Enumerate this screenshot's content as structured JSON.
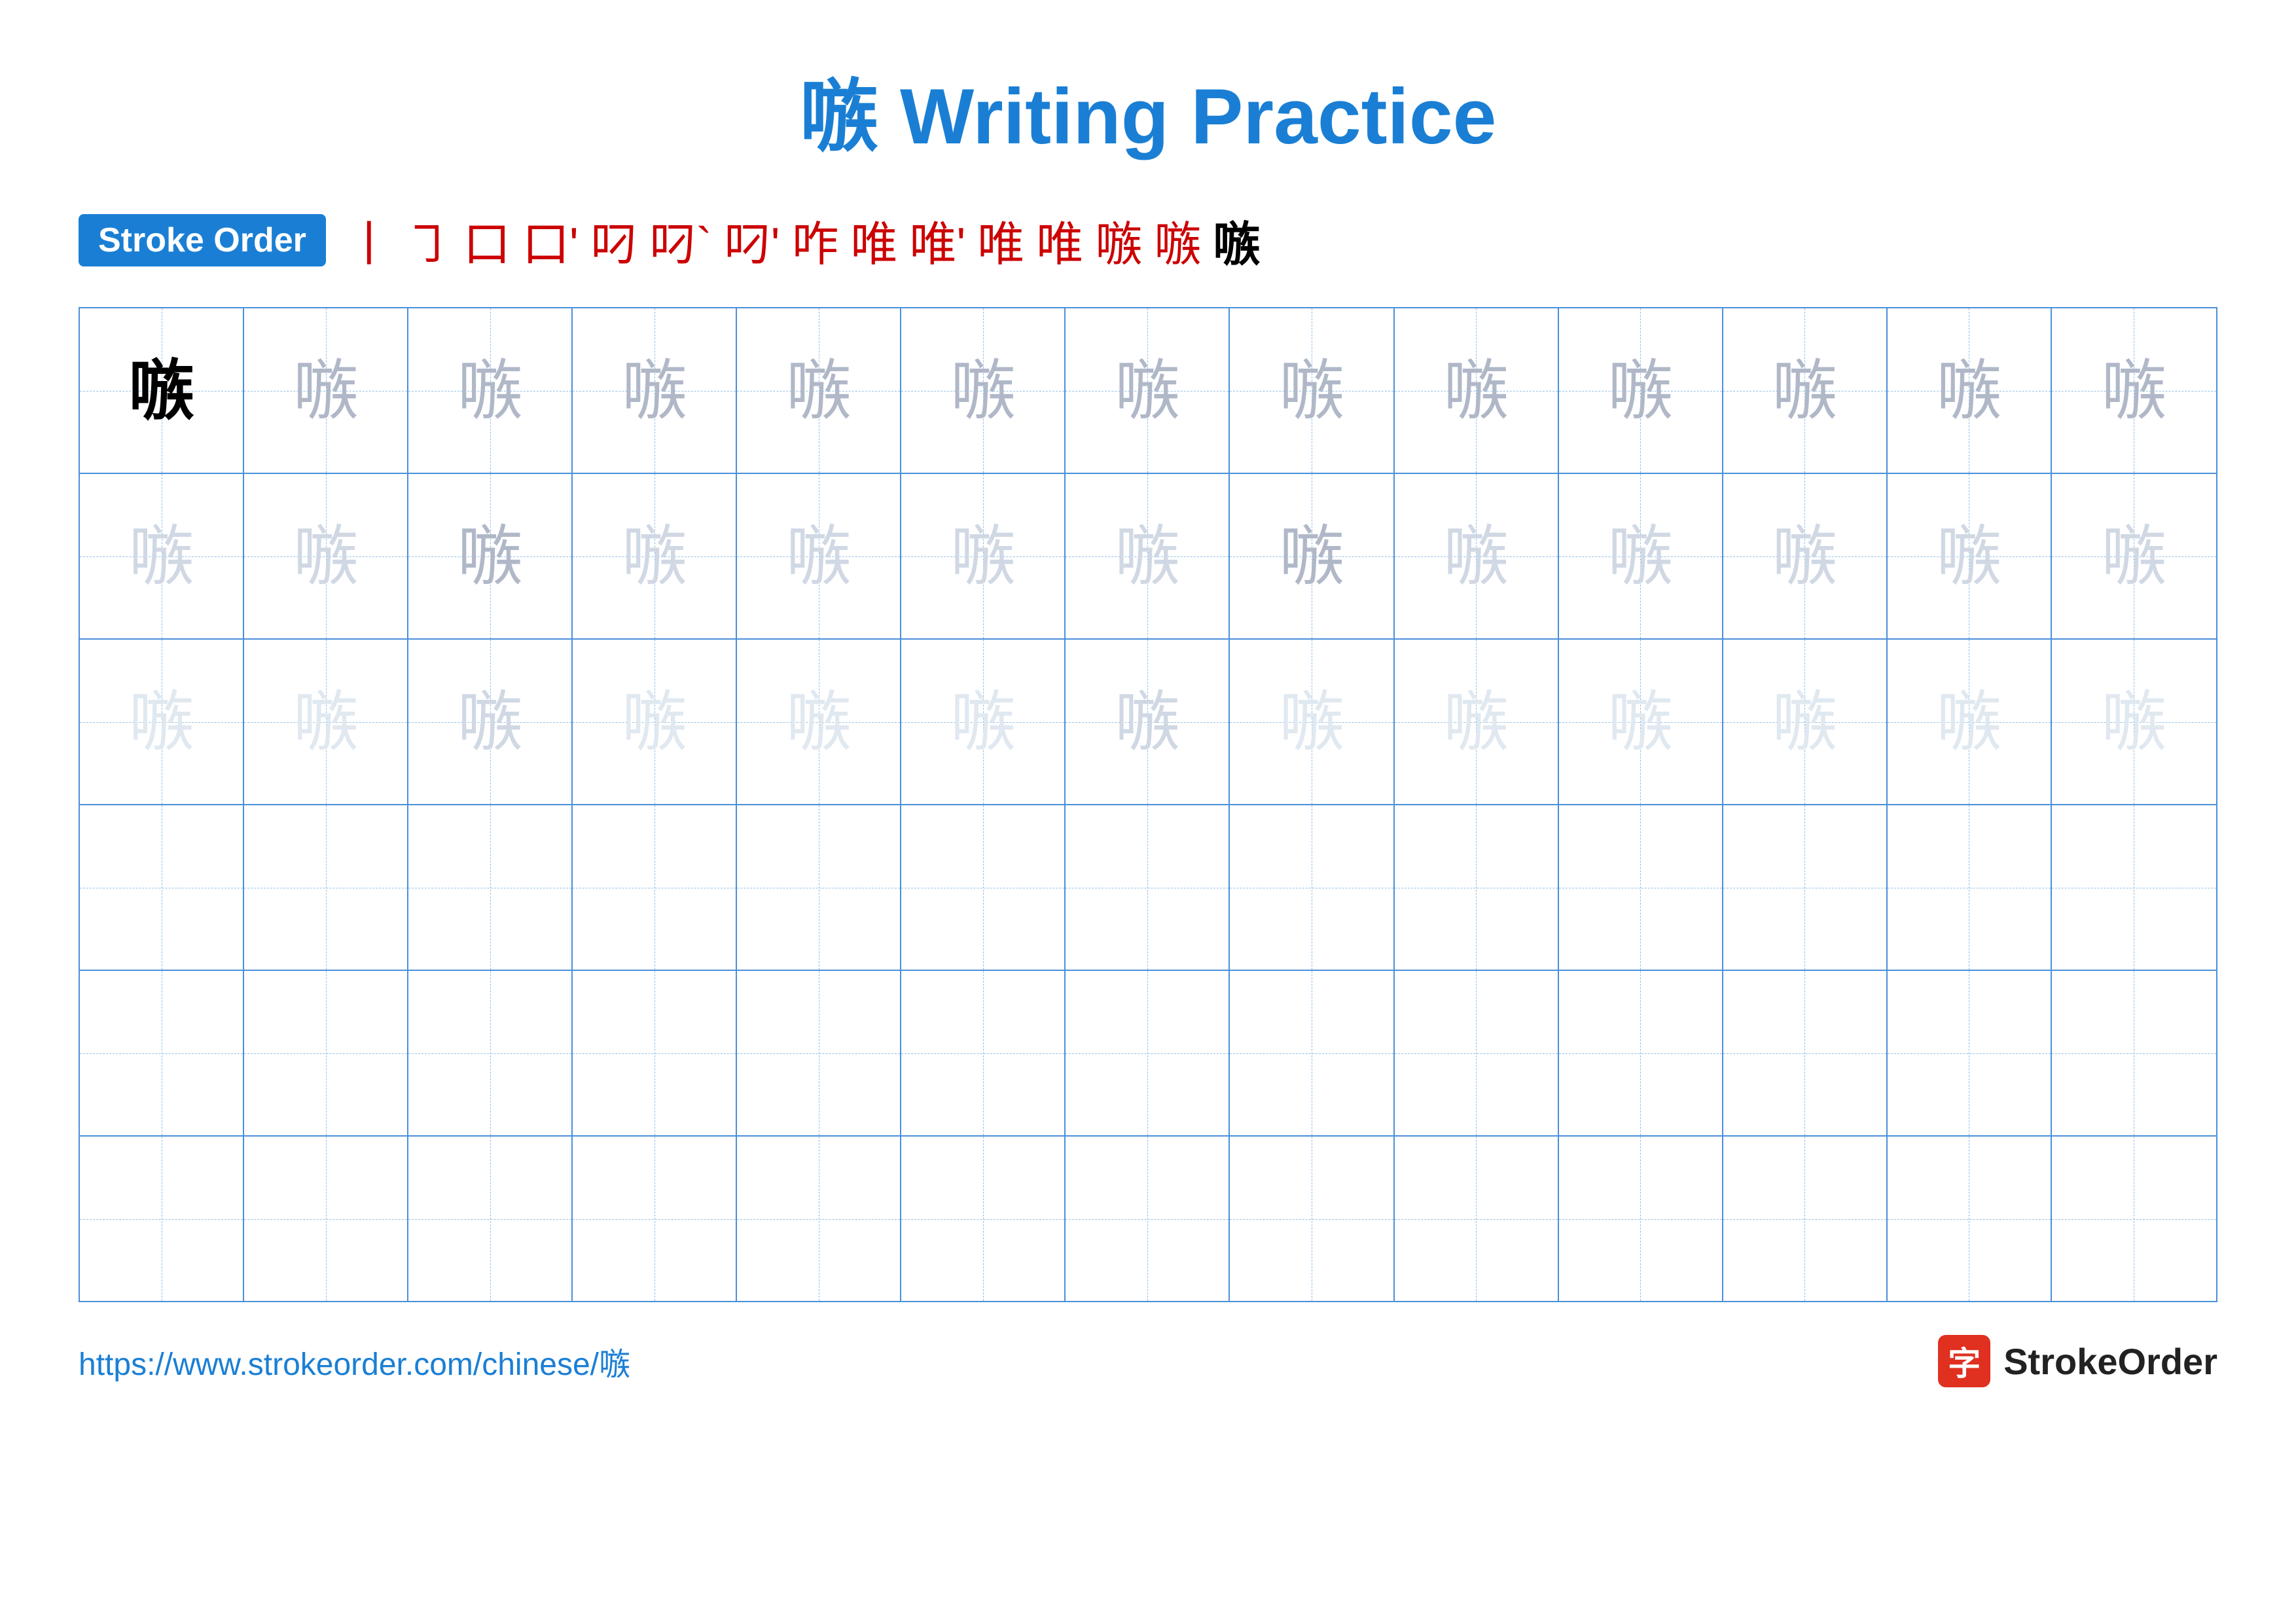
{
  "title": {
    "char": "嗾",
    "text": "嗾 Writing Practice"
  },
  "stroke_order": {
    "badge_label": "Stroke Order",
    "strokes": [
      "丨",
      "㇆",
      "口",
      "口'",
      "叼",
      "叼`",
      "叼'",
      "咋",
      "唯",
      "唯'",
      "唯",
      "唯",
      "嗾",
      "嗾",
      "嗾"
    ]
  },
  "grid": {
    "rows": 6,
    "cols": 13,
    "char": "嗾",
    "row_styles": [
      [
        "solid",
        "medium",
        "medium",
        "medium",
        "medium",
        "medium",
        "medium",
        "medium",
        "medium",
        "medium",
        "medium",
        "medium",
        "medium"
      ],
      [
        "light",
        "light",
        "medium",
        "light",
        "light",
        "light",
        "light",
        "medium",
        "light",
        "light",
        "light",
        "light",
        "light"
      ],
      [
        "light",
        "light",
        "medium",
        "light",
        "light",
        "light",
        "medium",
        "light",
        "light",
        "light",
        "light",
        "light",
        "light"
      ],
      [
        "empty",
        "empty",
        "empty",
        "empty",
        "empty",
        "empty",
        "empty",
        "empty",
        "empty",
        "empty",
        "empty",
        "empty",
        "empty"
      ],
      [
        "empty",
        "empty",
        "empty",
        "empty",
        "empty",
        "empty",
        "empty",
        "empty",
        "empty",
        "empty",
        "empty",
        "empty",
        "empty"
      ],
      [
        "empty",
        "empty",
        "empty",
        "empty",
        "empty",
        "empty",
        "empty",
        "empty",
        "empty",
        "empty",
        "empty",
        "empty",
        "empty"
      ]
    ]
  },
  "footer": {
    "url": "https://www.strokeorder.com/chinese/嗾",
    "logo_char": "字",
    "logo_text": "StrokeOrder"
  }
}
